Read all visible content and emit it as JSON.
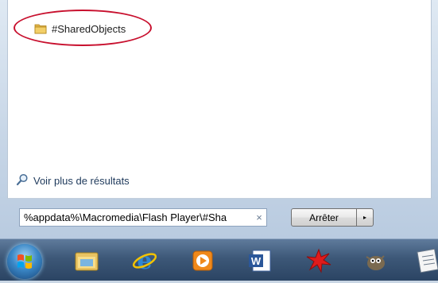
{
  "results": {
    "items": [
      {
        "label": "#SharedObjects",
        "icon": "folder-icon"
      }
    ],
    "more_results_label": "Voir plus de résultats"
  },
  "search": {
    "value": "%appdata%\\Macromedia\\Flash Player\\#Sha",
    "clear_glyph": "×"
  },
  "shutdown": {
    "label": "Arrêter",
    "arrow_glyph": "▸"
  },
  "taskbar": {
    "icons": [
      "windows-start-icon",
      "windows-explorer-icon",
      "internet-explorer-icon",
      "media-player-icon",
      "word-icon",
      "red-splat-app-icon",
      "gimp-icon",
      "notepad-icon"
    ]
  },
  "colors": {
    "highlight": "#c8102e",
    "link": "#1e395b"
  }
}
